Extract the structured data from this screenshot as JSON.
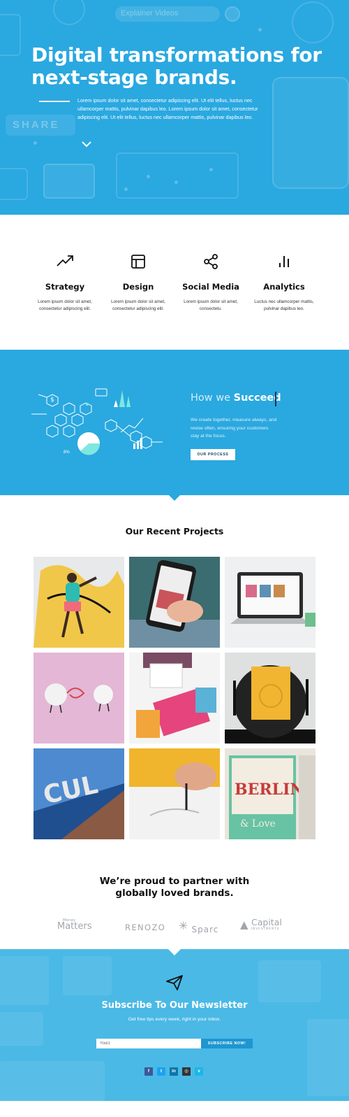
{
  "hero": {
    "ghost_search": "Explainer Videos",
    "ghost_share": "SHARE",
    "title": "Digital transformations for next-stage brands.",
    "body": "Lorem ipsum dolor sit amet, consectetur adipiscing elit. Ut elit tellus, luctus nec ullamcorper mattis, pulvinar dapibus leo. Lorem ipsum dolor sit amet, consectetur adipiscing elit. Ut elit tellus, luctus nec ullamcorper mattis, pulvinar dapibus leo.",
    "scroll_icon": "chevron-down-icon"
  },
  "features": [
    {
      "icon": "trending-up-icon",
      "title": "Strategy",
      "text": "Lorem ipsum dolor sit amet, consectetur adipiscing elit."
    },
    {
      "icon": "layout-icon",
      "title": "Design",
      "text": "Lorem ipsum dolor sit amet, consectetur adipiscing elit."
    },
    {
      "icon": "share-icon",
      "title": "Social Media",
      "text": "Lorem ipsum dolor sit amet, consectetu."
    },
    {
      "icon": "bar-chart-icon",
      "title": "Analytics",
      "text": "Luctus nec ullamcorper mattis, pulvinar dapibus leo."
    }
  ],
  "succeed": {
    "title_light": "How we",
    "title_bold": "Succeed",
    "illustration_label": "8%",
    "text": "We create together, measure always, and revise often, ensuring your customers stay at the focus.",
    "button": "OUR PROCESS"
  },
  "projects": {
    "title": "Our Recent Projects",
    "items": [
      {
        "name": "street-art-dancer"
      },
      {
        "name": "phone-in-hand"
      },
      {
        "name": "laptop-on-desk"
      },
      {
        "name": "cotton-characters"
      },
      {
        "name": "magazines-reading"
      },
      {
        "name": "graphic-design-book"
      },
      {
        "name": "building-facade"
      },
      {
        "name": "hand-drawing"
      },
      {
        "name": "berlin-posters"
      }
    ]
  },
  "partners": {
    "title_line1": "We’re proud to partner with",
    "title_line2": "globally loved brands.",
    "logos": [
      {
        "small": "Money",
        "big": "Matters"
      },
      {
        "big": "RENOZO"
      },
      {
        "big": "Sparc"
      },
      {
        "big": "Capital",
        "small": "INVESTMENTS"
      }
    ]
  },
  "newsletter": {
    "icon": "paper-plane-icon",
    "title": "Subscribe To Our Newsletter",
    "subtitle": "Get free tips every week, right in your inbox.",
    "email_value": "Youl1",
    "button": "SUBSCRIBE NOW!",
    "social": [
      {
        "icon": "facebook-icon",
        "glyph": "f",
        "color": "#3b5998"
      },
      {
        "icon": "twitter-icon",
        "glyph": "t",
        "color": "#1da1f2"
      },
      {
        "icon": "linkedin-icon",
        "glyph": "in",
        "color": "#0e76a8"
      },
      {
        "icon": "instagram-icon",
        "glyph": "◎",
        "color": "#333333"
      },
      {
        "icon": "vimeo-icon",
        "glyph": "v",
        "color": "#1ab7ea"
      }
    ]
  },
  "colors": {
    "brand_blue": "#2aa8e0",
    "newsletter_blue": "#4ab9e6",
    "button_blue": "#1e96d0"
  }
}
